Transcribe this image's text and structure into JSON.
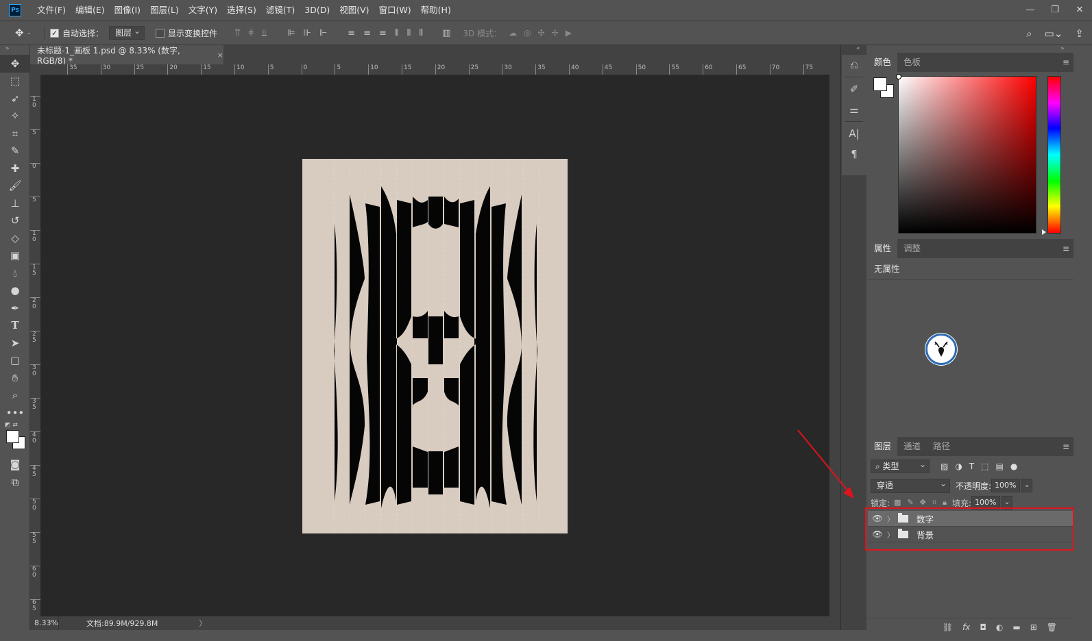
{
  "app": {
    "logo": "Ps"
  },
  "menu": [
    "文件(F)",
    "编辑(E)",
    "图像(I)",
    "图层(L)",
    "文字(Y)",
    "选择(S)",
    "滤镜(T)",
    "3D(D)",
    "视图(V)",
    "窗口(W)",
    "帮助(H)"
  ],
  "window_buttons": {
    "minimize": "—",
    "restore": "❐",
    "close": "✕"
  },
  "options": {
    "auto_select_label": "自动选择：",
    "auto_select_checked": true,
    "auto_select_target": "图层",
    "show_transform_label": "显示变换控件",
    "show_transform_checked": false,
    "mode_3d_label": "3D 模式："
  },
  "document": {
    "tab_title": "未标题-1_画板 1.psd @ 8.33% (数字, RGB/8) *",
    "close": "×",
    "artboard_color": "#d8cbc0",
    "canvas_bg": "#282828"
  },
  "ruler": {
    "h_labels": [
      "35",
      "30",
      "25",
      "20",
      "15",
      "10",
      "5",
      "0",
      "5",
      "10",
      "15",
      "20",
      "25",
      "30",
      "35",
      "40",
      "45",
      "50",
      "55",
      "60",
      "65",
      "70",
      "75"
    ],
    "v_labels": [
      "1\n0",
      "5",
      "0",
      "5",
      "1\n0",
      "1\n5",
      "2\n0",
      "2\n5",
      "3\n0",
      "3\n5",
      "4\n0",
      "4\n5",
      "5\n0",
      "5\n5",
      "6\n0",
      "6\n5"
    ]
  },
  "status": {
    "zoom": "8.33%",
    "doc_info": "文档:89.9M/929.8M",
    "arrow": "〉"
  },
  "tools": [
    "move-tool",
    "marquee-tool",
    "lasso-tool",
    "magic-wand-tool",
    "crop-tool",
    "eyedropper-tool",
    "healing-brush-tool",
    "brush-tool",
    "clone-stamp-tool",
    "history-brush-tool",
    "eraser-tool",
    "gradient-tool",
    "blur-tool",
    "dodge-tool",
    "pen-tool",
    "type-tool",
    "path-selection-tool",
    "shape-tool",
    "hand-tool",
    "zoom-tool",
    "more-tools"
  ],
  "panels": {
    "color": {
      "tabs": [
        "颜色",
        "色板"
      ],
      "active": 0
    },
    "properties": {
      "tabs": [
        "属性",
        "调整"
      ],
      "active": 0,
      "message": "无属性"
    },
    "layers": {
      "tabs": [
        "图层",
        "通道",
        "路径"
      ],
      "active": 0,
      "filter_kind": "类型",
      "blend_mode": "穿透",
      "opacity_label": "不透明度:",
      "opacity": "100%",
      "lock_label": "锁定:",
      "fill_label": "填充:",
      "fill": "100%",
      "items": [
        {
          "name": "数字",
          "visible": true,
          "selected": true,
          "type": "group"
        },
        {
          "name": "背景",
          "visible": true,
          "selected": false,
          "type": "group"
        }
      ]
    }
  },
  "annotation": {
    "color": "#e0141a"
  }
}
